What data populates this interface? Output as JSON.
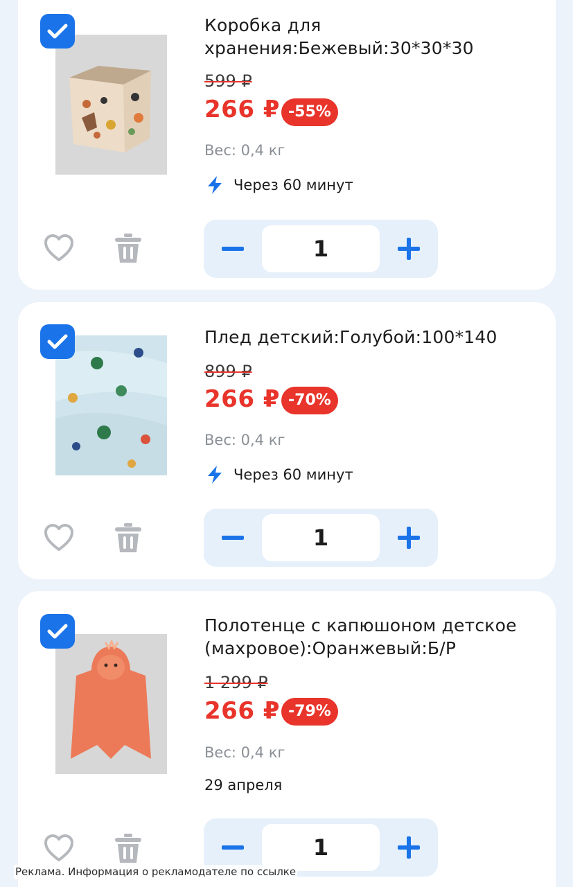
{
  "colors": {
    "accent": "#1a73e8",
    "price_red": "#e8342b",
    "stepper_bg": "#e6f0fb",
    "page_bg": "#edf3fa"
  },
  "items": [
    {
      "title": "Коробка для хранения:Бежевый:30*30*30",
      "old_price": "599 ₽",
      "price": "266 ₽",
      "discount": "-55%",
      "weight": "Вес: 0,4 кг",
      "delivery": "Через 60 минут",
      "date": "",
      "quantity": "1",
      "checked": true,
      "image": "storage-box-photo"
    },
    {
      "title": "Плед детский:Голубой:100*140",
      "old_price": "899 ₽",
      "price": "266 ₽",
      "discount": "-70%",
      "weight": "Вес: 0,4 кг",
      "delivery": "Через 60 минут",
      "date": "",
      "quantity": "1",
      "checked": true,
      "image": "blanket-photo"
    },
    {
      "title": "Полотенце с капюшоном детское (махровое):Оранжевый:Б/Р",
      "old_price": "1 299 ₽",
      "price": "266 ₽",
      "discount": "-79%",
      "weight": "Вес: 0,4 кг",
      "delivery": "",
      "date": "29 апреля",
      "quantity": "1",
      "checked": true,
      "image": "hooded-towel-photo"
    }
  ],
  "icons": {
    "checkbox": "checkmark-icon",
    "favorite": "heart-icon",
    "delete": "trash-icon",
    "delivery": "lightning-icon",
    "decrease": "minus-icon",
    "increase": "plus-icon"
  },
  "footer": {
    "ad_note": "Реклама. Информация о рекламодателе по ссылке"
  }
}
